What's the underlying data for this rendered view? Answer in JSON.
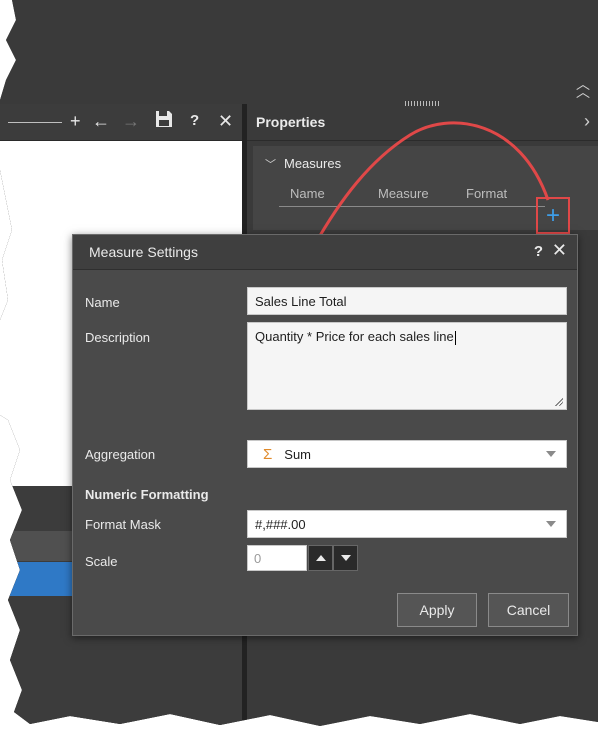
{
  "left_toolbar": {
    "icons": [
      "plus-icon",
      "back-arrow-icon",
      "forward-arrow-icon",
      "save-icon",
      "help-icon",
      "close-icon"
    ],
    "help_text": "?"
  },
  "properties": {
    "title": "Properties",
    "measures": {
      "title": "Measures",
      "columns": [
        "Name",
        "Measure",
        "Format"
      ],
      "add_symbol": "+"
    }
  },
  "dialog": {
    "title": "Measure Settings",
    "help_symbol": "?",
    "name": {
      "label": "Name",
      "value": "Sales Line Total"
    },
    "description": {
      "label": "Description",
      "value": "Quantity * Price for each sales line"
    },
    "aggregation": {
      "label": "Aggregation",
      "symbol": "Σ",
      "value": "Sum"
    },
    "numeric_formatting": "Numeric Formatting",
    "format_mask": {
      "label": "Format Mask",
      "value": "#,###.00"
    },
    "scale": {
      "label": "Scale",
      "value": "0"
    },
    "apply_label": "Apply",
    "cancel_label": "Cancel"
  },
  "colors": {
    "accent_red": "#e04848",
    "plus_blue": "#3e9ee8",
    "selection_blue": "#2f79c6",
    "sigma_orange": "#e08a2a"
  }
}
